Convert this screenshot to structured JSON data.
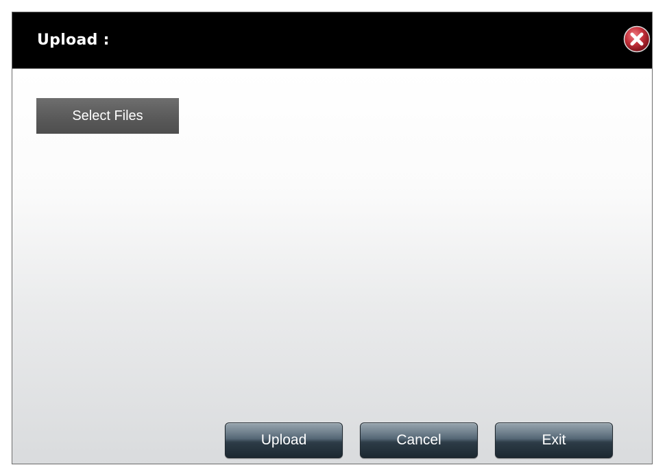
{
  "dialog": {
    "title": "Upload :",
    "close_icon": "close-x-icon",
    "title_bar_color": "#000000",
    "close_icon_color": "#c2303a"
  },
  "main": {
    "select_files_label": "Select Files"
  },
  "footer": {
    "upload_label": "Upload",
    "cancel_label": "Cancel",
    "exit_label": "Exit"
  }
}
